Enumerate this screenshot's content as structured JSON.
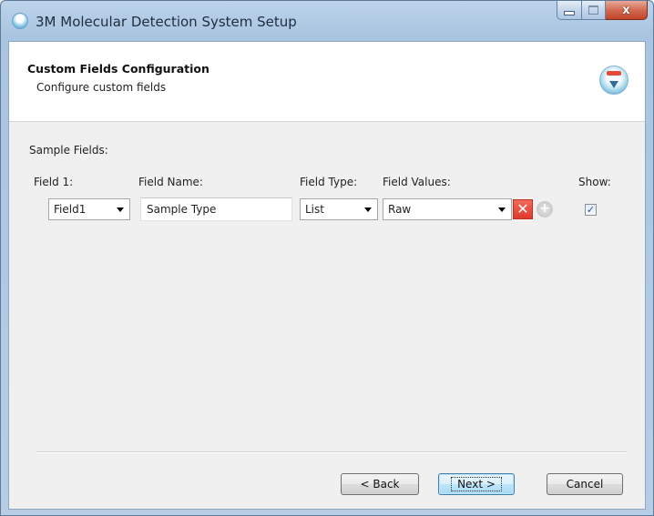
{
  "window": {
    "title": "3M Molecular Detection System Setup",
    "close_glyph": "x"
  },
  "header": {
    "title": "Custom Fields Configuration",
    "subtitle": "Configure custom fields"
  },
  "section": {
    "label": "Sample Fields:"
  },
  "columns": {
    "field": "Field 1:",
    "field_name": "Field Name:",
    "field_type": "Field Type:",
    "field_values": "Field Values:",
    "show": "Show:"
  },
  "row": {
    "field_select": "Field1",
    "field_name_value": "Sample Type",
    "field_type_select": "List",
    "field_values_select": "Raw",
    "delete_glyph": "✕",
    "add_glyph": "+",
    "show_checked": true,
    "check_glyph": "✓"
  },
  "buttons": {
    "back": "< Back",
    "next": "Next >",
    "cancel": "Cancel"
  },
  "colors": {
    "delete": "#df3a2b",
    "default_button": "#3c7fb1"
  }
}
